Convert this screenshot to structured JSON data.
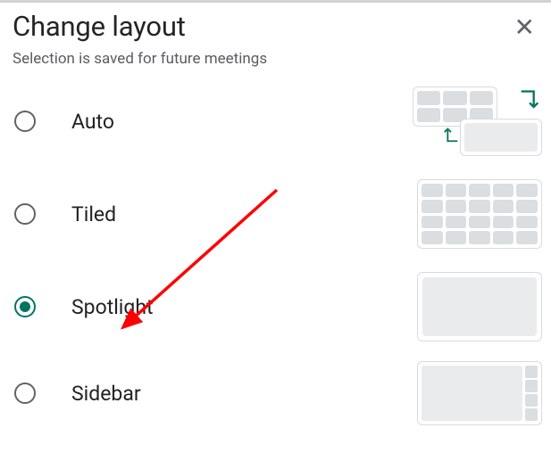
{
  "dialog": {
    "title": "Change layout",
    "subtitle": "Selection is saved for future meetings"
  },
  "options": [
    {
      "id": "auto",
      "label": "Auto",
      "selected": false
    },
    {
      "id": "tiled",
      "label": "Tiled",
      "selected": false
    },
    {
      "id": "spotlight",
      "label": "Spotlight",
      "selected": true
    },
    {
      "id": "sidebar",
      "label": "Sidebar",
      "selected": false
    }
  ]
}
